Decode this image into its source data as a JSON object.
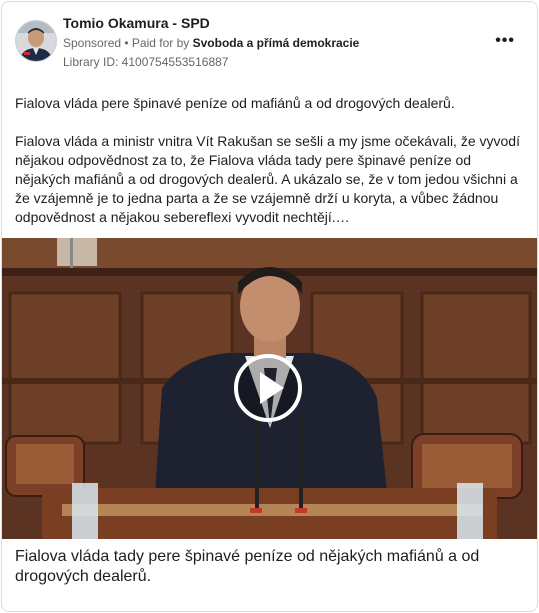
{
  "post": {
    "author": "Tomio Okamura - SPD",
    "sponsored_label": "Sponsored",
    "separator": " • ",
    "paid_for_prefix": "Paid for by ",
    "paid_for_name": "Svoboda a přímá demokracie",
    "library_id": "Library ID: 4100754553516887",
    "more_label": "•••",
    "headline": "Fialova vláda pere špinavé peníze od mafiánů a od drogových dealerů.",
    "paragraph": "Fialova vláda a ministr vnitra Vít Rakušan se sešli a my jsme očekávali, že vyvodí nějakou odpovědnost za to, že Fialova vláda tady pere špinavé peníze od nějakých mafiánů a od drogových dealerů. A ukázalo se, že v tom jedou všichni a že vzájemně je to jedna parta a že se vzájemně drží u koryta, a vůbec žádnou odpovědnost a nějakou sebereflexi vyvodit nechtějí.…",
    "video_caption": "Fialova vláda tady pere špinavé peníze od nějakých mafiánů a od drogových dealerů."
  },
  "colors": {
    "text_primary": "#1c1e21",
    "text_secondary": "#65676b",
    "border": "#dadde1",
    "wood": "#6b3b22"
  },
  "icons": {
    "more": "more-horizontal-icon",
    "play": "play-icon",
    "avatar": "profile-photo"
  }
}
